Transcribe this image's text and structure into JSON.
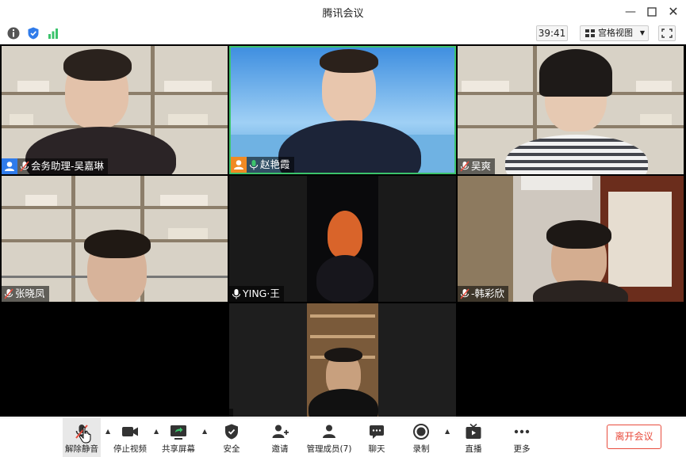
{
  "window": {
    "title": "腾讯会议"
  },
  "infobar": {
    "timer": "39:41",
    "view_label": "宫格视图"
  },
  "participants": [
    {
      "name": "会务助理-吴嘉琳"
    },
    {
      "name": "赵艳霞"
    },
    {
      "name": "吴爽"
    },
    {
      "name": "张晓凤"
    },
    {
      "name": "YING·王"
    },
    {
      "name": "-韩彩欣"
    },
    {
      "name": ""
    }
  ],
  "toolbar": {
    "unmute": "解除静音",
    "stop_video": "停止视频",
    "share_screen": "共享屏幕",
    "security": "安全",
    "invite": "邀请",
    "manage_members": "管理成员(7)",
    "chat": "聊天",
    "record": "录制",
    "live": "直播",
    "more": "更多",
    "leave": "离开会议"
  },
  "colors": {
    "accent": "#2f7bea",
    "leave": "#e84c3d",
    "active_speaker": "#3cc36c"
  }
}
